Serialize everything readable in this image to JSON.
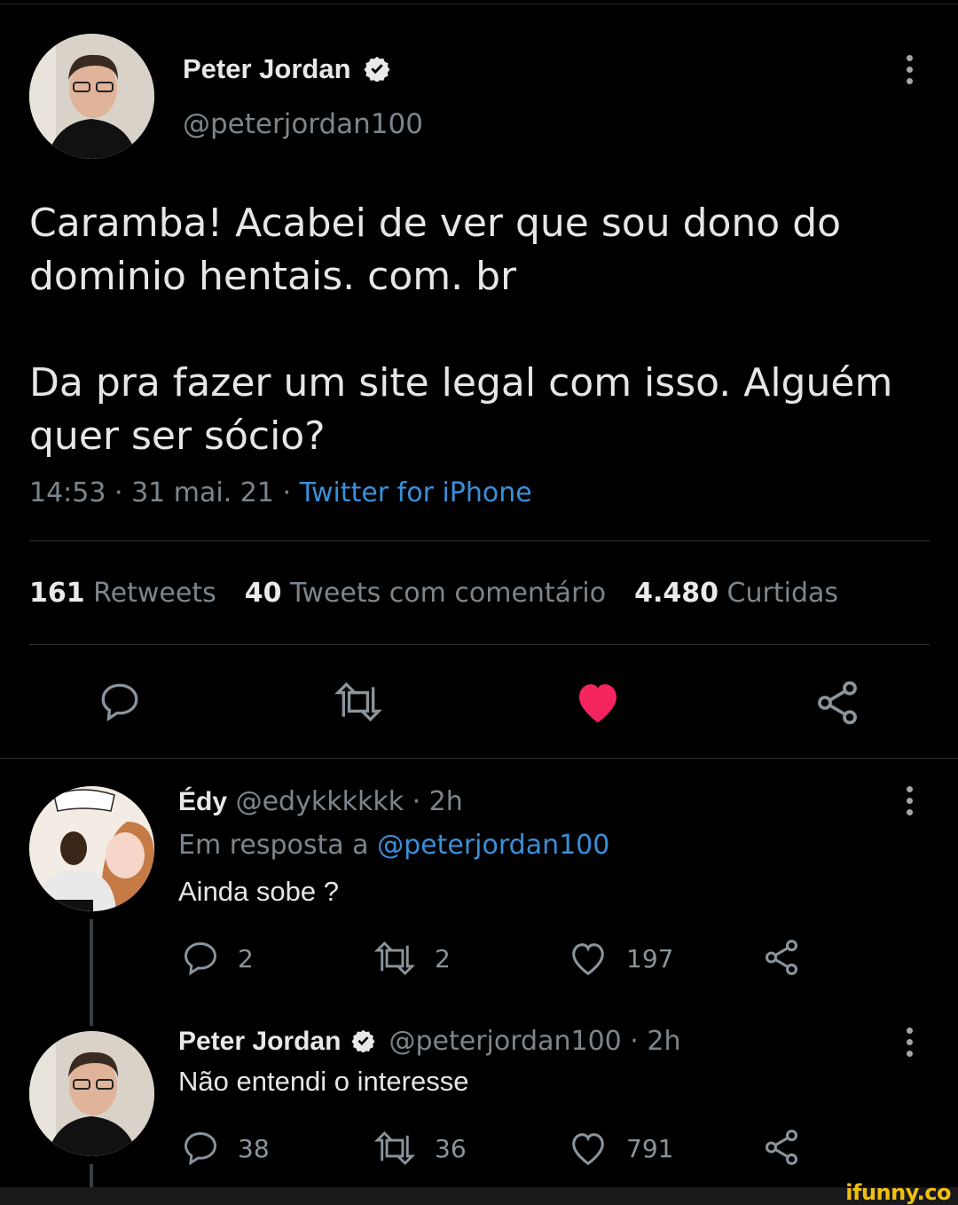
{
  "main_tweet": {
    "author_name": "Peter Jordan",
    "handle": "@peterjordan100",
    "text_line1": "Caramba! Acabei de ver que sou dono do",
    "text_line2": "dominio hentais. com. br",
    "text_line3": "Da pra fazer um site legal com isso. Alguém",
    "text_line4": "quer ser sócio?",
    "timestamp": "14:53 · 31 mai. 21 · ",
    "source": "Twitter for iPhone",
    "stats": {
      "retweets_count": "161",
      "retweets_label": "Retweets",
      "quotes_count": "40",
      "quotes_label": "Tweets com comentário",
      "likes_count": "4.480",
      "likes_label": "Curtidas"
    }
  },
  "reply1": {
    "author_name": "Édy",
    "handle_time": "@edykkkkkk · 2h",
    "in_reply_prefix": "Em resposta a ",
    "in_reply_handle": "@peterjordan100",
    "text": "Ainda sobe ?",
    "reply_count": "2",
    "retweet_count": "2",
    "like_count": "197"
  },
  "reply2": {
    "author_name": "Peter Jordan",
    "handle_time": "@peterjordan100 · 2h",
    "text": "Não entendi o interesse",
    "reply_count": "38",
    "retweet_count": "36",
    "like_count": "791"
  },
  "watermark": "ifunny.co",
  "colors": {
    "background": "#000000",
    "link": "#3a8fd9",
    "like_active": "#f4245e",
    "verified": "#e8e8e8"
  }
}
